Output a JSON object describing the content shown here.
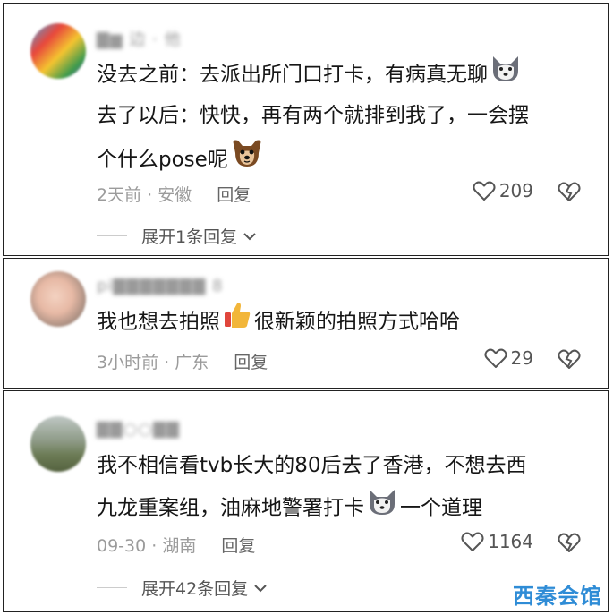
{
  "comments": [
    {
      "username": "▇▆ 边 · 他",
      "lines": [
        "没去之前：去派出所门口打卡，有病真无聊",
        "去了以后：快快，再有两个就排到我了，一会摆",
        "个什么pose呢"
      ],
      "emoji_1": "husky-emoji",
      "emoji_2": "dog-emoji",
      "time": "2天前",
      "location": "安徽",
      "reply": "回复",
      "likes": "209",
      "expand": "展开1条回复"
    },
    {
      "username": "pi▇▇▇▇▇▇▇ 8",
      "text_before": "我也想去拍照",
      "text_after": "很新颖的拍照方式哈哈",
      "emoji_1": "thumbs-up-emoji",
      "time": "3小时前",
      "location": "广东",
      "reply": "回复",
      "likes": "29"
    },
    {
      "username": "▇▇○○▇▇",
      "line_1": "我不相信看tvb长大的80后去了香港，不想去西",
      "line_2_before": "九龙重案组，油麻地警署打卡",
      "line_2_after": "一个道理",
      "emoji_1": "husky-emoji",
      "time": "09-30",
      "location": "湖南",
      "reply": "回复",
      "likes": "1164",
      "expand": "展开42条回复"
    }
  ],
  "separator": "·",
  "watermark": "西秦会馆",
  "colors": {
    "meta": "#9b9b9b",
    "text": "#161616",
    "watermark": "#2f8cd6"
  }
}
